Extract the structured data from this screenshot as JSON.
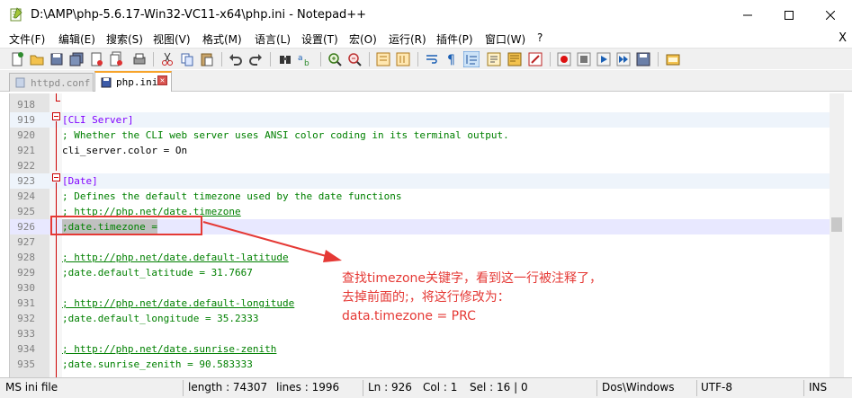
{
  "window": {
    "title": "D:\\AMP\\php-5.6.17-Win32-VC11-x64\\php.ini - Notepad++"
  },
  "menu": [
    "文件(F)",
    "编辑(E)",
    "搜索(S)",
    "视图(V)",
    "格式(M)",
    "语言(L)",
    "设置(T)",
    "宏(O)",
    "运行(R)",
    "插件(P)",
    "窗口(W)",
    "?"
  ],
  "menu_close": "X",
  "tabs": [
    {
      "label": "httpd.conf",
      "active": false
    },
    {
      "label": "php.ini",
      "active": true
    }
  ],
  "editor": {
    "lines": [
      {
        "n": "918",
        "text": ""
      },
      {
        "n": "919",
        "text": "[CLI Server]",
        "kind": "section"
      },
      {
        "n": "920",
        "text": "; Whether the CLI web server uses ANSI color coding in its terminal output.",
        "kind": "comment"
      },
      {
        "n": "921",
        "text": "cli_server.color = On",
        "kind": "key"
      },
      {
        "n": "922",
        "text": ""
      },
      {
        "n": "923",
        "text": "[Date]",
        "kind": "section"
      },
      {
        "n": "924",
        "text": "; Defines the default timezone used by the date functions",
        "kind": "comment"
      },
      {
        "n": "925",
        "text": "; http://php.net/date.timezone",
        "kind": "link"
      },
      {
        "n": "926",
        "text": ";date.timezone =",
        "kind": "selected"
      },
      {
        "n": "927",
        "text": ""
      },
      {
        "n": "928",
        "text": "; http://php.net/date.default-latitude",
        "kind": "link"
      },
      {
        "n": "929",
        "text": ";date.default_latitude = 31.7667",
        "kind": "comment"
      },
      {
        "n": "930",
        "text": ""
      },
      {
        "n": "931",
        "text": "; http://php.net/date.default-longitude",
        "kind": "link"
      },
      {
        "n": "932",
        "text": ";date.default_longitude = 35.2333",
        "kind": "comment"
      },
      {
        "n": "933",
        "text": ""
      },
      {
        "n": "934",
        "text": "; http://php.net/date.sunrise-zenith",
        "kind": "link"
      },
      {
        "n": "935",
        "text": ";date.sunrise_zenith = 90.583333",
        "kind": "comment"
      }
    ]
  },
  "annotation": {
    "lines": [
      "查找timezone关键字，看到这一行被注释了，",
      "去掉前面的;，将这行修改为：",
      "data.timezone = PRC"
    ]
  },
  "status": {
    "filetype": "MS ini file",
    "length": "length : 74307",
    "lines": "lines : 1996",
    "ln": "Ln : 926",
    "col": "Col : 1",
    "sel": "Sel : 16 | 0",
    "eol": "Dos\\Windows",
    "encoding": "UTF-8",
    "mode": "INS"
  },
  "colors": {
    "annotation": "#e53935",
    "section": "#8000ff",
    "comment": "#008000"
  }
}
